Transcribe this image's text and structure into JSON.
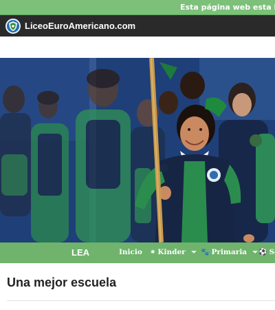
{
  "banner": {
    "text": "Esta página web esta bajo construcción"
  },
  "header": {
    "site_name": "LiceoEuroAmericano.com",
    "logo_icon": "school-crest-icon"
  },
  "hero": {
    "description_icon": "students-parade-photo"
  },
  "navbar": {
    "brand": "LEA",
    "items": [
      {
        "label": "Inicio",
        "icon": "",
        "has_dropdown": false
      },
      {
        "label": "Kinder",
        "icon": "sun-icon",
        "has_dropdown": true
      },
      {
        "label": "Primaria",
        "icon": "paw-icon",
        "has_dropdown": true
      },
      {
        "label": "Se",
        "icon": "soccer-ball-icon",
        "has_dropdown": false
      }
    ]
  },
  "main": {
    "headline": "Una mejor escuela"
  },
  "colors": {
    "banner_bg": "#7dc07a",
    "brand_bar_bg": "#2a2a2a",
    "nav_bg": "#6fb36c"
  }
}
